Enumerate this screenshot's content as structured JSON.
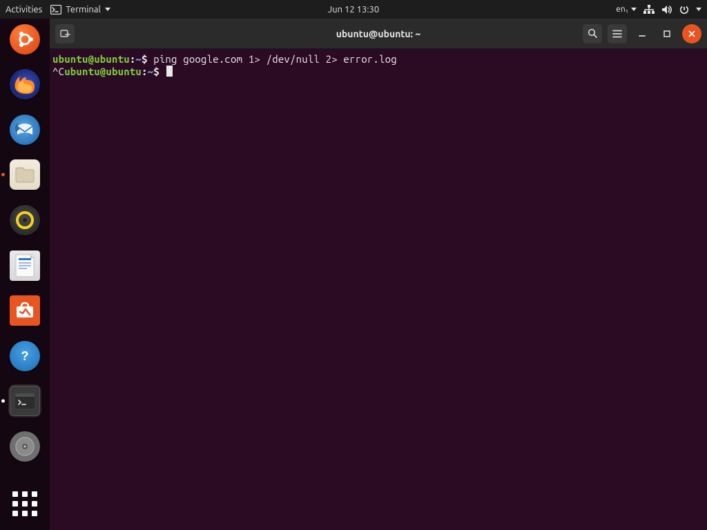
{
  "topbar": {
    "activities_label": "Activities",
    "app_menu_label": "Terminal",
    "clock": "Jun 12  13:30",
    "input_source": "en₁"
  },
  "dock": {
    "items": [
      {
        "name": "show-applications",
        "label": "Show Applications"
      },
      {
        "name": "firefox",
        "label": "Firefox"
      },
      {
        "name": "thunderbird",
        "label": "Thunderbird"
      },
      {
        "name": "files",
        "label": "Files",
        "running": true
      },
      {
        "name": "rhythmbox",
        "label": "Rhythmbox"
      },
      {
        "name": "libreoffice-writer",
        "label": "LibreOffice Writer"
      },
      {
        "name": "ubuntu-software",
        "label": "Ubuntu Software"
      },
      {
        "name": "help",
        "label": "Help"
      },
      {
        "name": "terminal",
        "label": "Terminal",
        "running": true,
        "active": true
      },
      {
        "name": "disk",
        "label": "Removable Disk"
      }
    ],
    "apps_button_label": "Show Applications"
  },
  "window": {
    "title": "ubuntu@ubuntu: ~",
    "new_tab_tooltip": "New Tab",
    "search_tooltip": "Search",
    "menu_tooltip": "Menu",
    "minimize_tooltip": "Minimize",
    "maximize_tooltip": "Maximize",
    "close_tooltip": "Close"
  },
  "terminal": {
    "lines": [
      {
        "prompt_user": "ubuntu@ubuntu",
        "prompt_sep": ":",
        "prompt_path": "~",
        "prompt_end": "$ ",
        "text": "ping google.com 1> /dev/null 2> error.log"
      },
      {
        "prefix": "^C",
        "prompt_user": "ubuntu@ubuntu",
        "prompt_sep": ":",
        "prompt_path": "~",
        "prompt_end": "$ ",
        "text": "",
        "cursor": true
      }
    ]
  },
  "colors": {
    "accent": "#E95420",
    "terminal_bg": "#2B0A24",
    "prompt_user": "#7CCB3C",
    "prompt_path": "#6B9FD4"
  }
}
